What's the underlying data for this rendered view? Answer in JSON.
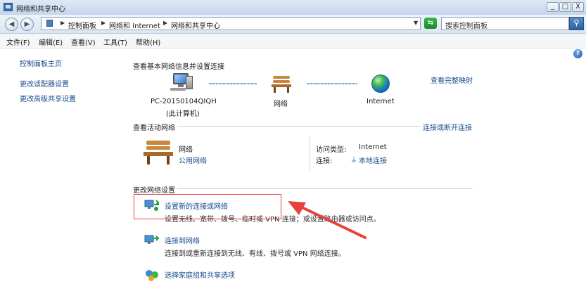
{
  "window": {
    "title": "网络和共享中心"
  },
  "titlebar_buttons": {
    "minimize": "_",
    "maximize": "□",
    "close": "X"
  },
  "address": {
    "crumbs": [
      "控制面板",
      "网络和 Internet",
      "网络和共享中心"
    ],
    "search_placeholder": "搜索控制面板"
  },
  "menu": [
    "文件(F)",
    "编辑(E)",
    "查看(V)",
    "工具(T)",
    "帮助(H)"
  ],
  "left_nav": [
    "控制面板主页",
    "更改适配器设置",
    "更改高级共享设置"
  ],
  "overview": {
    "heading": "查看基本网络信息并设置连接",
    "full_map_link": "查看完整映射",
    "computer_name": "PC-20150104QIQH",
    "computer_sub": "(此计算机)",
    "network_label": "网络",
    "internet_label": "Internet"
  },
  "active": {
    "heading": "查看活动网络",
    "connect_link": "连接或断开连接",
    "network_name": "网络",
    "network_type": "公用网络",
    "access_label": "访问类型:",
    "access_value": "Internet",
    "connection_label": "连接:",
    "connection_value": "本地连接"
  },
  "change": {
    "heading": "更改网络设置",
    "items": [
      {
        "title": "设置新的连接或网络",
        "desc": "设置无线、宽带、拨号、临时或 VPN 连接；或设置路由器或访问点。"
      },
      {
        "title": "连接到网络",
        "desc": "连接到或重新连接到无线、有线、拨号或 VPN 网络连接。"
      },
      {
        "title": "选择家庭组和共享选项",
        "desc": ""
      }
    ]
  },
  "colors": {
    "link": "#1a4b8c",
    "annotation": "#e8423c"
  }
}
